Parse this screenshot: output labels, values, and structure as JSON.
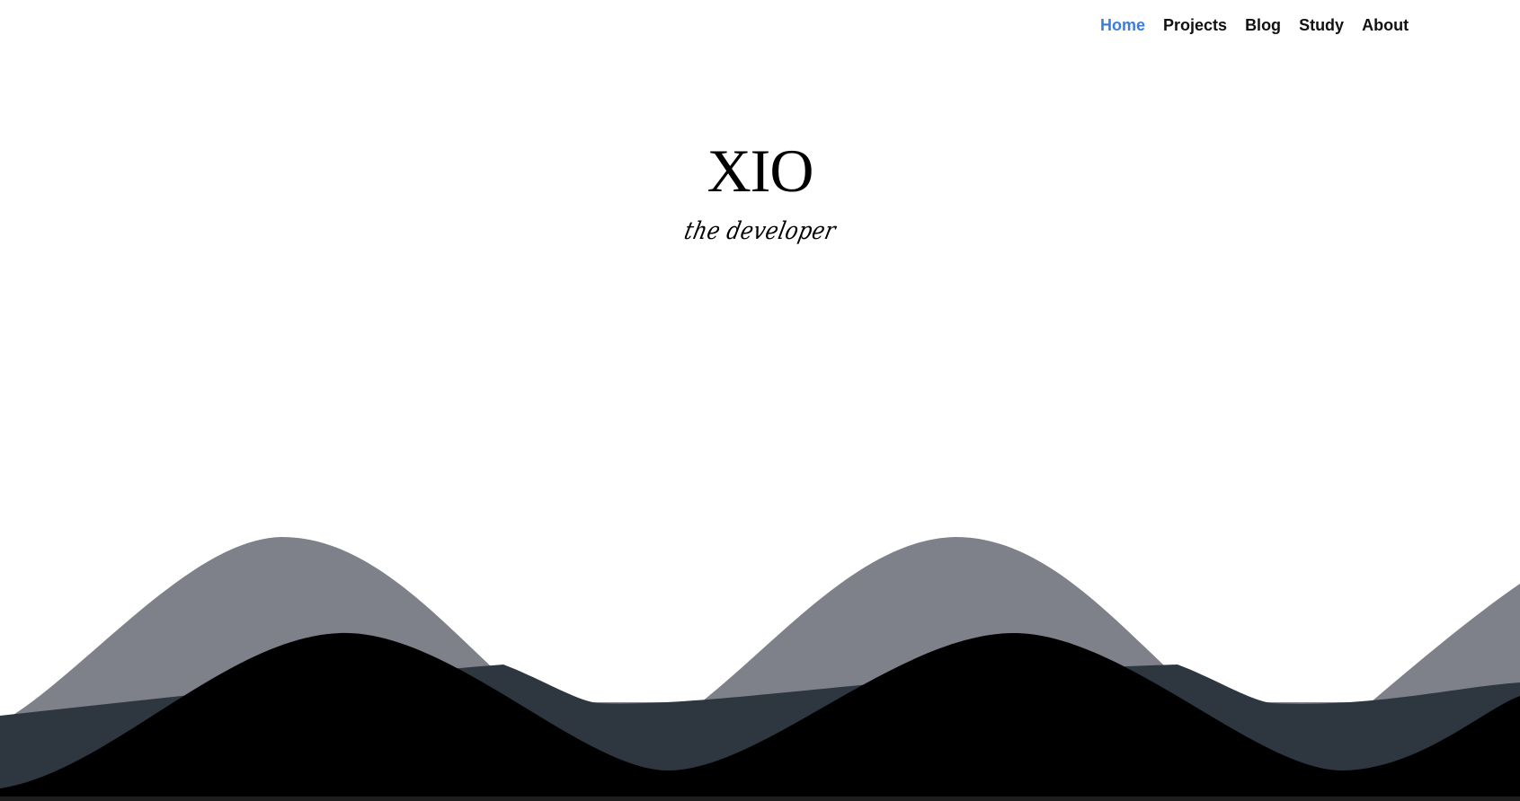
{
  "nav": {
    "items": [
      {
        "label": "Home",
        "active": true
      },
      {
        "label": "Projects",
        "active": false
      },
      {
        "label": "Blog",
        "active": false
      },
      {
        "label": "Study",
        "active": false
      },
      {
        "label": "About",
        "active": false
      }
    ]
  },
  "hero": {
    "title": "XIO",
    "subtitle": "the developer"
  },
  "colors": {
    "nav_active": "#3b7ddd",
    "nav_text": "#111111",
    "wave_back": "#7e808a",
    "wave_mid": "#2e3640",
    "wave_front": "#000000",
    "bottom_bar": "#1e1e1e"
  }
}
